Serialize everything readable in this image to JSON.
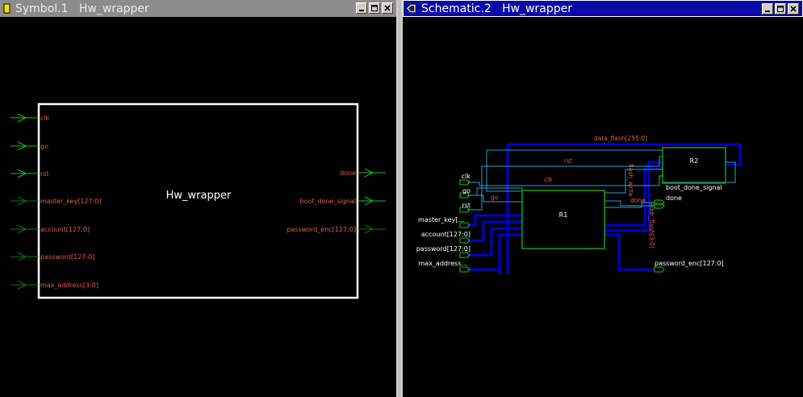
{
  "left_window": {
    "title": "Symbol.1   Hw_wrapper",
    "symbol": {
      "block_name": "Hw_wrapper",
      "inputs": [
        "clk",
        "go",
        "rst",
        "master_key[127:0]",
        "account[127:0]",
        "password[127:0]",
        "max_address[3:0]"
      ],
      "outputs": [
        "done",
        "boot_done_signal",
        "password_enc[127:0]"
      ]
    }
  },
  "right_window": {
    "title": "Schematic.2   Hw_wrapper",
    "schematic": {
      "instances": [
        "R1",
        "R2"
      ],
      "ports_in": [
        "clk",
        "go",
        "rst",
        "master_key[...",
        "account[127:0]",
        "password[127:0]",
        "max_address..."
      ],
      "ports_out": [
        "boot_done_signal",
        "done",
        "password_enc[127:0]"
      ],
      "net_labels": [
        "data_flash[255:0]",
        "rst",
        "clk",
        "go",
        "flash_write",
        "done",
        "addr_flash[3:0]"
      ]
    }
  },
  "icons": [
    "window-icon",
    "minimize-icon",
    "maximize-icon",
    "close-icon"
  ],
  "colors": {
    "wire": "#2aa1d6",
    "bus": "#0000d2",
    "instance": "#16a016",
    "pin_in": "#12c812",
    "label": "#d86050"
  }
}
